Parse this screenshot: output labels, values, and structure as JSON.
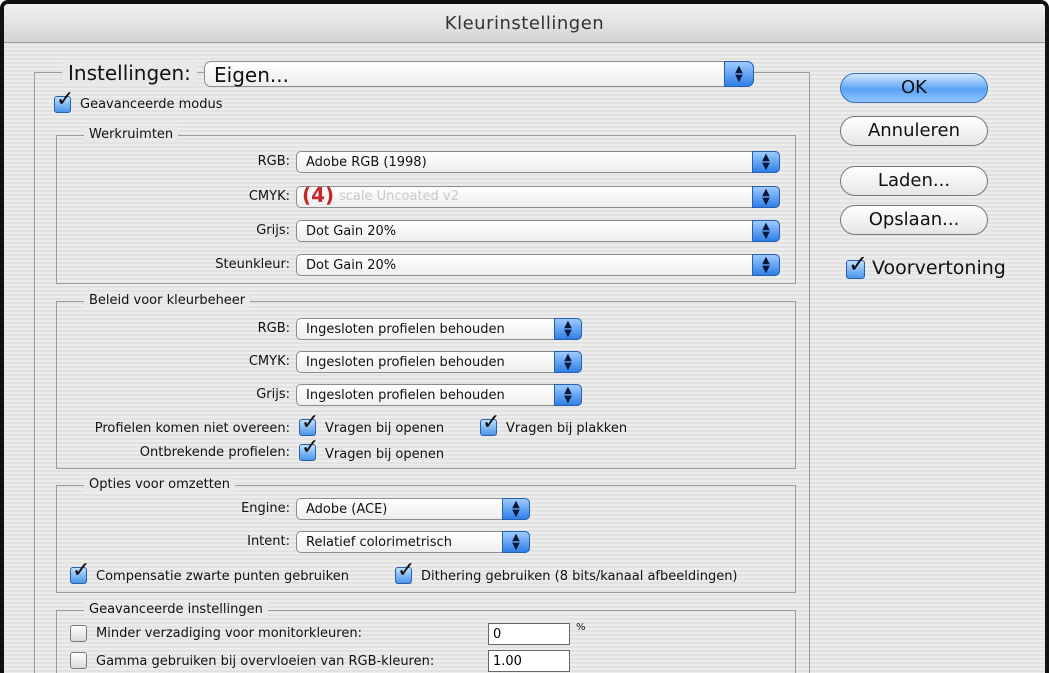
{
  "window": {
    "title": "Kleurinstellingen"
  },
  "settings": {
    "label": "Instellingen:",
    "value": "Eigen..."
  },
  "advanced_mode": {
    "label": "Geavanceerde modus",
    "checked": true
  },
  "workspaces": {
    "legend": "Werkruimten",
    "rgb": {
      "label": "RGB:",
      "value": "Adobe RGB (1998)"
    },
    "cmyk": {
      "label": "CMYK:",
      "value": "",
      "ghost_text": "scale Uncoated v2",
      "callout": "(4)"
    },
    "gray": {
      "label": "Grijs:",
      "value": "Dot Gain 20%"
    },
    "spot": {
      "label": "Steunkleur:",
      "value": "Dot Gain 20%"
    }
  },
  "policies": {
    "legend": "Beleid voor kleurbeheer",
    "rgb": {
      "label": "RGB:",
      "value": "Ingesloten profielen behouden"
    },
    "cmyk": {
      "label": "CMYK:",
      "value": "Ingesloten profielen behouden"
    },
    "gray": {
      "label": "Grijs:",
      "value": "Ingesloten profielen behouden"
    },
    "mismatch": {
      "label": "Profielen komen niet overeen:",
      "ask_open": "Vragen bij openen",
      "ask_paste": "Vragen bij plakken"
    },
    "missing": {
      "label": "Ontbrekende profielen:",
      "ask_open": "Vragen bij openen"
    }
  },
  "conversion": {
    "legend": "Opties voor omzetten",
    "engine": {
      "label": "Engine:",
      "value": "Adobe (ACE)"
    },
    "intent": {
      "label": "Intent:",
      "value": "Relatief colorimetrisch"
    },
    "black_point": "Compensatie zwarte punten gebruiken",
    "dither": "Dithering gebruiken (8 bits/kanaal afbeeldingen)"
  },
  "advanced": {
    "legend": "Geavanceerde instellingen",
    "desaturate": {
      "label": "Minder verzadiging voor monitorkleuren:",
      "value": "0",
      "unit": "%"
    },
    "gamma": {
      "label": "Gamma gebruiken bij overvloeien van RGB-kleuren:",
      "value": "1.00"
    }
  },
  "buttons": {
    "ok": "OK",
    "cancel": "Annuleren",
    "load": "Laden...",
    "save": "Opslaan...",
    "preview": "Voorvertoning"
  },
  "colors": {
    "accent": "#4a95ea",
    "callout": "#c62828"
  }
}
